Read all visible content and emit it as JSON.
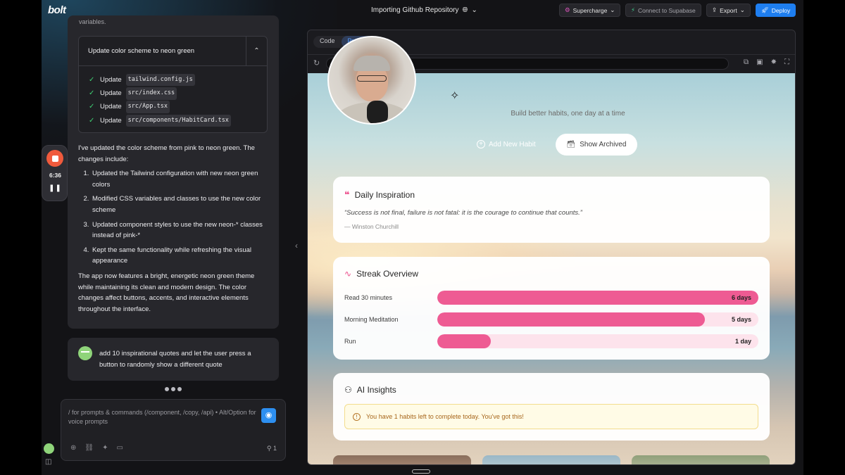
{
  "topbar": {
    "logo": "bolt",
    "project_title": "Importing Github Repository",
    "supercharge_label": "Supercharge",
    "supabase_label": "Connect to Supabase",
    "export_label": "Export",
    "deploy_label": "Deploy"
  },
  "recording": {
    "time": "6:36"
  },
  "chat": {
    "cut_text": "variables.",
    "action_box": {
      "title": "Update color scheme to neon green",
      "items": [
        {
          "verb": "Update",
          "file": "tailwind.config.js"
        },
        {
          "verb": "Update",
          "file": "src/index.css"
        },
        {
          "verb": "Update",
          "file": "src/App.tsx"
        },
        {
          "verb": "Update",
          "file": "src/components/HabitCard.tsx"
        }
      ]
    },
    "intro": "I've updated the color scheme from pink to neon green. The changes include:",
    "changes": [
      "Updated the Tailwind configuration with new neon green colors",
      "Modified CSS variables and classes to use the new color scheme",
      "Updated component styles to use the new neon-* classes instead of pink-*",
      "Kept the same functionality while refreshing the visual appearance"
    ],
    "summary": "The app now features a bright, energetic neon green theme while maintaining its clean and modern design. The color changes affect buttons, accents, and interactive elements throughout the interface.",
    "user_message": "add 10 inspirational quotes and let the user press a button to randomly show a different quote"
  },
  "prompt": {
    "placeholder": "/ for prompts & commands (/component, /copy, /api) • Alt/Option for voice prompts",
    "count": "1"
  },
  "workbench": {
    "tabs": [
      "Code",
      "Preview"
    ],
    "active_tab": "Preview"
  },
  "preview": {
    "tagline": "Build better habits, one day at a time",
    "add_habit_label": "Add New Habit",
    "show_archived_label": "Show Archived",
    "inspiration": {
      "title": "Daily Inspiration",
      "quote": "“Success is not final, failure is not fatal: it is the courage to continue that counts.”",
      "author": "— Winston Churchill"
    },
    "streak": {
      "title": "Streak Overview",
      "max_days": 6,
      "rows": [
        {
          "label": "Read 30 minutes",
          "value": "6 days",
          "days": 6
        },
        {
          "label": "Morning Meditation",
          "value": "5 days",
          "days": 5
        },
        {
          "label": "Run",
          "value": "1 day",
          "days": 1
        }
      ]
    },
    "insights": {
      "title": "AI Insights",
      "message": "You have 1 habits left to complete today. You've got this!"
    }
  },
  "colors": {
    "accent_pink": "#ee5b93",
    "deploy_blue": "#1e7ef0",
    "check_green": "#3fcf73"
  }
}
